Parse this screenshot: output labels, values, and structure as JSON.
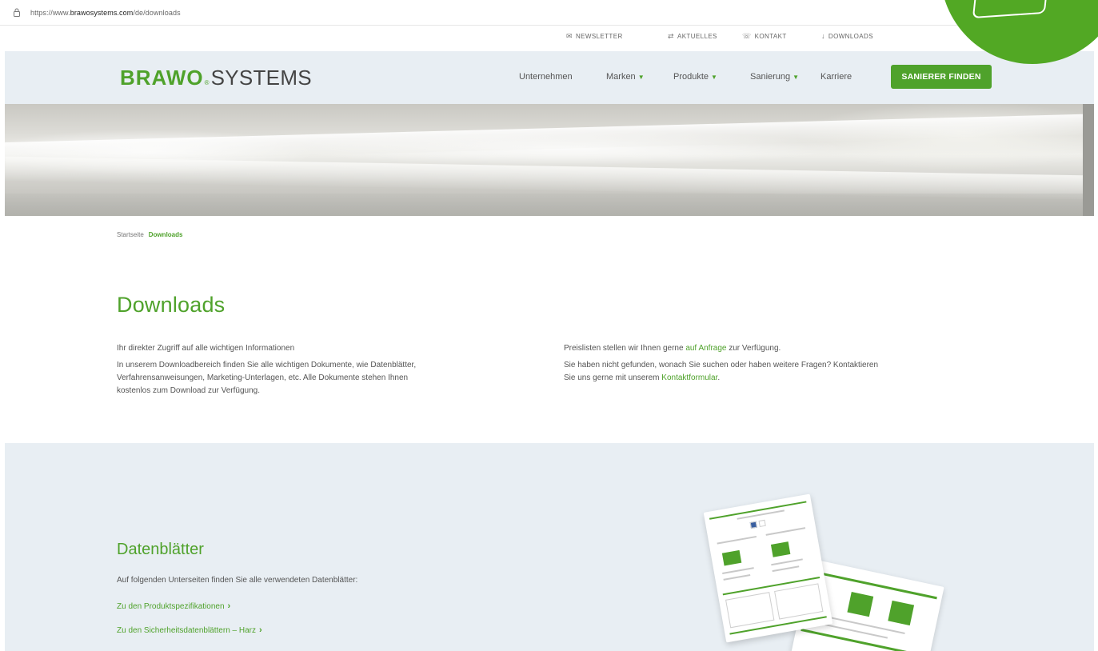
{
  "browser": {
    "url_prefix": "https://www.",
    "url_host": "brawosystems.com",
    "url_path": "/de/downloads"
  },
  "utility": {
    "newsletter": "NEWSLETTER",
    "aktuelles": "AKTUELLES",
    "kontakt": "KONTAKT",
    "downloads": "DOWNLOADS"
  },
  "header": {
    "logo_brawo": "BRAWO",
    "logo_mark": "®",
    "logo_systems": "SYSTEMS",
    "nav": {
      "unternehmen": "Unternehmen",
      "marken": "Marken",
      "produkte": "Produkte",
      "sanierung": "Sanierung",
      "karriere": "Karriere"
    },
    "cta": "SANIERER FINDEN"
  },
  "breadcrumb": {
    "home": "Startseite",
    "current": "Downloads"
  },
  "intro": {
    "title": "Downloads",
    "left_p1": "Ihr direkter Zugriff auf alle wichtigen Informationen",
    "left_p2_line1": "In unserem Downloadbereich finden Sie alle wichtigen Dokumente, wie Datenblätter,",
    "left_p2_line2": "Verfahrensanweisungen, Marketing-Unterlagen, etc. Alle Dokumente stehen Ihnen",
    "left_p2_line3": "kostenlos zum Download zur Verfügung.",
    "right_p1_before": "Preislisten stellen wir Ihnen gerne ",
    "right_p1_link": "auf Anfrage",
    "right_p1_after": " zur Verfügung.",
    "right_p2_line1": "Sie haben nicht gefunden, wonach Sie suchen oder haben weitere Fragen? Kontaktieren",
    "right_p2_line2_before": "Sie uns gerne mit unserem ",
    "right_p2_link": "Kontaktformular",
    "right_p2_line2_after": "."
  },
  "datenblaetter": {
    "title": "Datenblätter",
    "text": "Auf folgenden Unterseiten finden Sie alle verwendeten Datenblätter:",
    "link1": "Zu den Produktspezifikationen",
    "link2": "Zu den Sicherheitsdatenblättern – Harz",
    "chevron": "›"
  },
  "colors": {
    "brand_green": "#4fa22b",
    "band_bg": "#e8eef3"
  }
}
